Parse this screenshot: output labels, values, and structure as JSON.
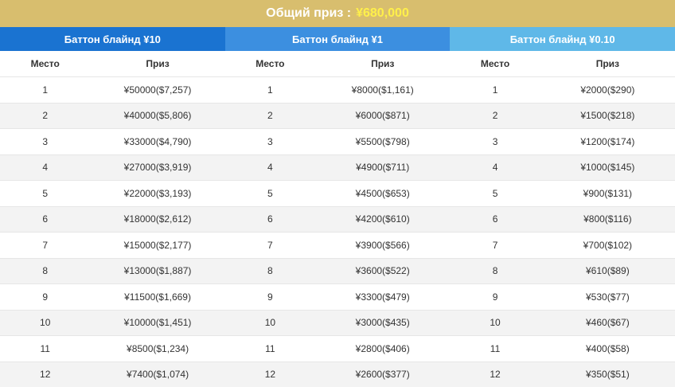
{
  "banner": {
    "label": "Общий приз :",
    "amount": "¥680,000"
  },
  "headers": {
    "place": "Место",
    "prize": "Приз"
  },
  "tables": [
    {
      "tab": "Баттон блайнд ¥10",
      "rows": [
        {
          "place": "1",
          "prize": "¥50000($7,257)"
        },
        {
          "place": "2",
          "prize": "¥40000($5,806)"
        },
        {
          "place": "3",
          "prize": "¥33000($4,790)"
        },
        {
          "place": "4",
          "prize": "¥27000($3,919)"
        },
        {
          "place": "5",
          "prize": "¥22000($3,193)"
        },
        {
          "place": "6",
          "prize": "¥18000($2,612)"
        },
        {
          "place": "7",
          "prize": "¥15000($2,177)"
        },
        {
          "place": "8",
          "prize": "¥13000($1,887)"
        },
        {
          "place": "9",
          "prize": "¥11500($1,669)"
        },
        {
          "place": "10",
          "prize": "¥10000($1,451)"
        },
        {
          "place": "11",
          "prize": "¥8500($1,234)"
        },
        {
          "place": "12",
          "prize": "¥7400($1,074)"
        }
      ]
    },
    {
      "tab": "Баттон блайнд ¥1",
      "rows": [
        {
          "place": "1",
          "prize": "¥8000($1,161)"
        },
        {
          "place": "2",
          "prize": "¥6000($871)"
        },
        {
          "place": "3",
          "prize": "¥5500($798)"
        },
        {
          "place": "4",
          "prize": "¥4900($711)"
        },
        {
          "place": "5",
          "prize": "¥4500($653)"
        },
        {
          "place": "6",
          "prize": "¥4200($610)"
        },
        {
          "place": "7",
          "prize": "¥3900($566)"
        },
        {
          "place": "8",
          "prize": "¥3600($522)"
        },
        {
          "place": "9",
          "prize": "¥3300($479)"
        },
        {
          "place": "10",
          "prize": "¥3000($435)"
        },
        {
          "place": "11",
          "prize": "¥2800($406)"
        },
        {
          "place": "12",
          "prize": "¥2600($377)"
        }
      ]
    },
    {
      "tab": "Баттон блайнд ¥0.10",
      "rows": [
        {
          "place": "1",
          "prize": "¥2000($290)"
        },
        {
          "place": "2",
          "prize": "¥1500($218)"
        },
        {
          "place": "3",
          "prize": "¥1200($174)"
        },
        {
          "place": "4",
          "prize": "¥1000($145)"
        },
        {
          "place": "5",
          "prize": "¥900($131)"
        },
        {
          "place": "6",
          "prize": "¥800($116)"
        },
        {
          "place": "7",
          "prize": "¥700($102)"
        },
        {
          "place": "8",
          "prize": "¥610($89)"
        },
        {
          "place": "9",
          "prize": "¥530($77)"
        },
        {
          "place": "10",
          "prize": "¥460($67)"
        },
        {
          "place": "11",
          "prize": "¥400($58)"
        },
        {
          "place": "12",
          "prize": "¥350($51)"
        }
      ]
    }
  ],
  "colors": {
    "banner": "#d8be6e",
    "amount": "#fff04a",
    "tab_1": "#1a73d1",
    "tab_2": "#3c8fe0",
    "tab_3": "#5fb8e8"
  }
}
